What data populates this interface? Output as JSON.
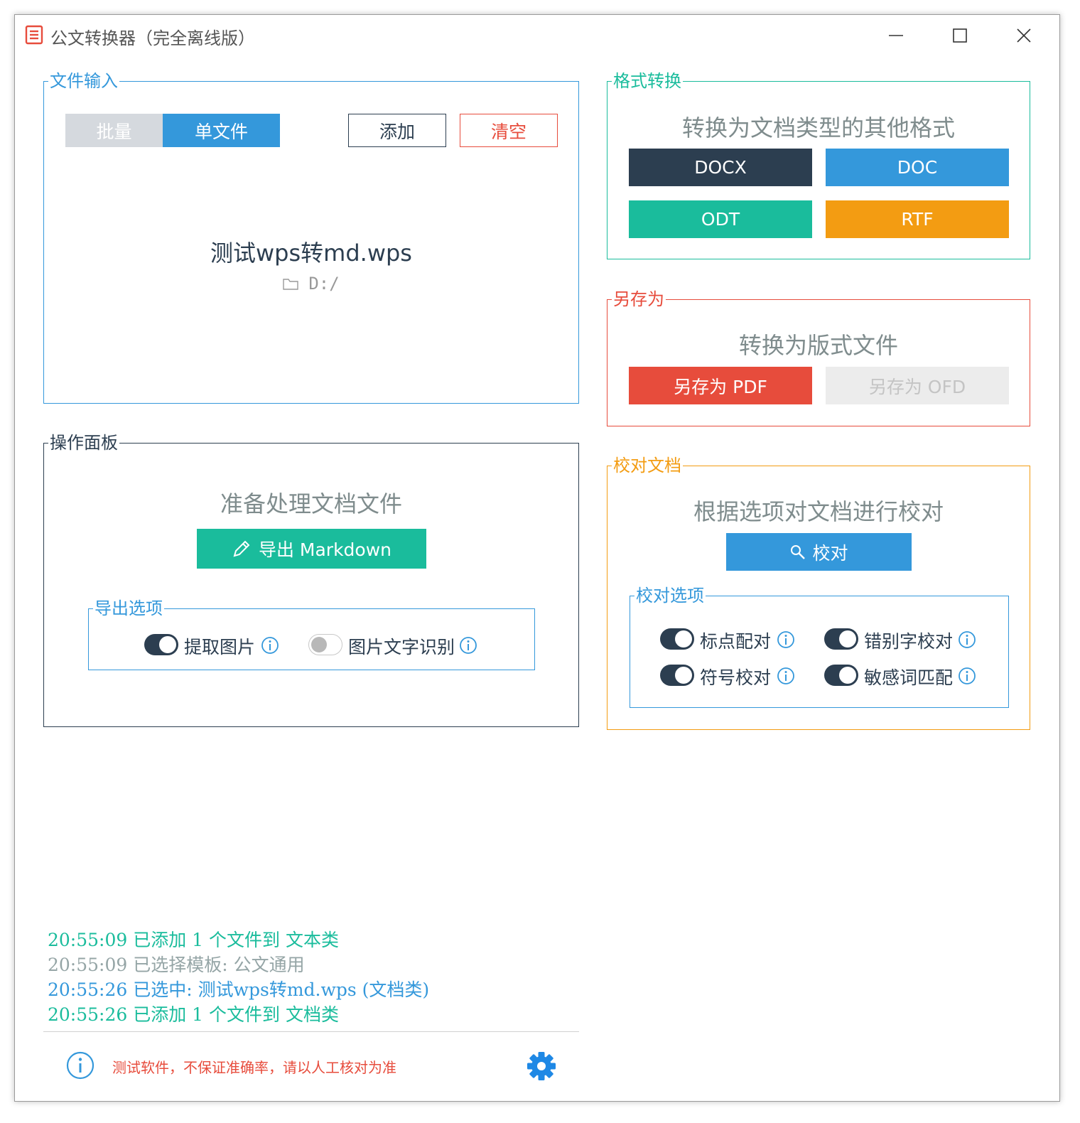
{
  "window": {
    "title": "公文转换器（完全离线版）"
  },
  "file_input": {
    "legend": "文件输入",
    "mode_batch": "批量",
    "mode_single": "单文件",
    "add_label": "添加",
    "clear_label": "清空",
    "file_name": "测试wps转md.wps",
    "file_path": "D:/"
  },
  "ops": {
    "legend": "操作面板",
    "status": "准备处理文档文件",
    "export_label": "导出 Markdown",
    "export_options": {
      "legend": "导出选项",
      "items": [
        {
          "label": "提取图片",
          "on": true
        },
        {
          "label": "图片文字识别",
          "on": false
        }
      ]
    }
  },
  "format": {
    "legend": "格式转换",
    "subtitle": "转换为文档类型的其他格式",
    "buttons": [
      "DOCX",
      "DOC",
      "ODT",
      "RTF"
    ]
  },
  "save_as": {
    "legend": "另存为",
    "subtitle": "转换为版式文件",
    "pdf_label": "另存为 PDF",
    "ofd_label": "另存为 OFD"
  },
  "proof": {
    "legend": "校对文档",
    "subtitle": "根据选项对文档进行校对",
    "button_label": "校对",
    "options": {
      "legend": "校对选项",
      "items": [
        {
          "label": "标点配对",
          "on": true
        },
        {
          "label": "错别字校对",
          "on": true
        },
        {
          "label": "符号校对",
          "on": true
        },
        {
          "label": "敏感词匹配",
          "on": true
        }
      ]
    }
  },
  "log": [
    {
      "text": "20:55:09 已添加 1 个文件到 文本类"
    },
    {
      "text": "20:55:09 已选择模板: 公文通用"
    },
    {
      "text": "20:55:26 已选中: 测试wps转md.wps (文档类)"
    },
    {
      "text": "20:55:26 已添加 1 个文件到 文档类"
    }
  ],
  "footer": {
    "notice": "测试软件，不保证准确率，请以人工核对为准"
  },
  "colors": {
    "primary": "#3498db",
    "dark": "#2c3e50",
    "teal": "#1abc9c",
    "orange": "#f39c12",
    "red": "#e74c3c",
    "muted": "#7f8c8d"
  }
}
